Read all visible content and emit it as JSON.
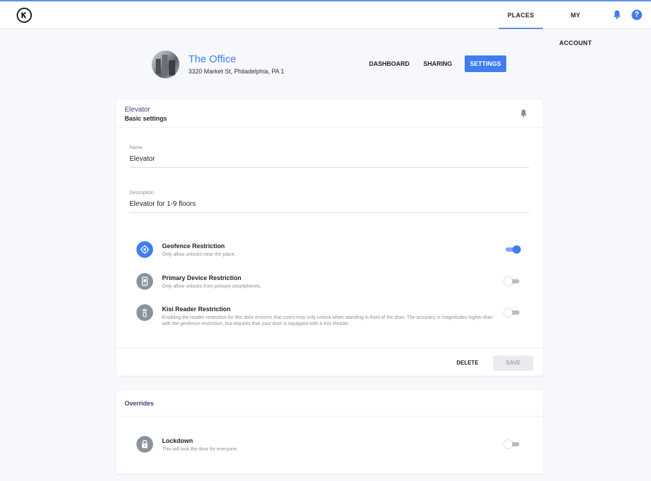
{
  "topbar": {
    "nav": [
      {
        "label": "PLACES",
        "active": true
      },
      {
        "label": "MY ACCOUNT",
        "active": false
      }
    ],
    "help_glyph": "?",
    "accent": "#3f7df0"
  },
  "place": {
    "title": "The Office",
    "address": "3320 Market St, Philadelphia, PA 1",
    "tabs": [
      {
        "label": "DASHBOARD",
        "active": false
      },
      {
        "label": "SHARING",
        "active": false
      },
      {
        "label": "SETTINGS",
        "active": true
      }
    ]
  },
  "door": {
    "kicker": "Elevator",
    "section": "Basic settings",
    "fields": {
      "name": {
        "label": "Name",
        "value": "Elevator"
      },
      "description": {
        "label": "Description",
        "value": "Elevator for 1-9 floors"
      }
    },
    "restrictions": [
      {
        "title": "Geofence Restriction",
        "desc": "Only allow unlocks near the place.",
        "enabled": true,
        "icon": "geofence-icon"
      },
      {
        "title": "Primary Device Restriction",
        "desc": "Only allow unlocks from primary smartphones.",
        "enabled": false,
        "icon": "phone-icon"
      },
      {
        "title": "Kisi Reader Restriction",
        "desc": "Enabling the reader restriction for this door ensures that users may only unlock when standing in front of the door. The accuracy is magnitudes higher than with the geofence restriction, but requires that your door is equipped with a Kisi Reader.",
        "enabled": false,
        "icon": "reader-icon"
      }
    ],
    "actions": {
      "delete": "DELETE",
      "save": "SAVE"
    }
  },
  "overrides": {
    "title": "Overrides",
    "lockdown": {
      "title": "Lockdown",
      "desc": "This will lock the door for everyone.",
      "enabled": false,
      "icon": "lock-icon"
    }
  }
}
